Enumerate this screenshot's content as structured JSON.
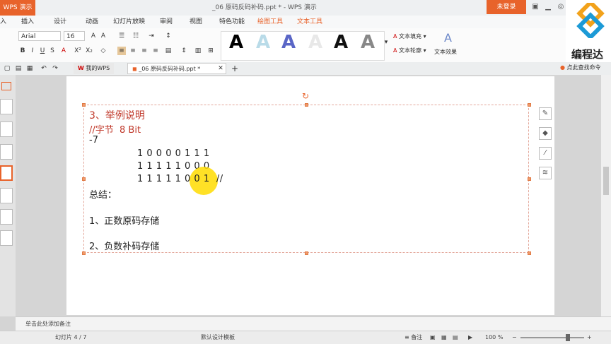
{
  "titlebar": {
    "app_label": "WPS 演示",
    "doc_title": "_06 原码反码补码.ppt * - WPS 演示",
    "login_label": "未登录",
    "controls": [
      "restore-icon",
      "minimize-icon",
      "maximize-icon",
      "close-icon"
    ]
  },
  "menu": {
    "items": [
      "入",
      "插入",
      "设计",
      "动画",
      "幻灯片放映",
      "审阅",
      "视图",
      "特色功能",
      "绘图工具",
      "文本工具"
    ],
    "active": "文本工具"
  },
  "toolbar": {
    "font_name": "Arial",
    "font_size": "16",
    "text_fill_label": "文本填充",
    "text_outline_label": "文本轮廓",
    "text_effect_label": "文本效果"
  },
  "logo": {
    "text": "编程达"
  },
  "tabs": {
    "home_tab": "我的WPS",
    "doc_tab": "_06 原码反码补码.ppt *",
    "search_label": "点此查找命令"
  },
  "slide": {
    "line1": "3、举例说明",
    "line2": "//字节  8 Bit",
    "line3": "-7",
    "line4": "1 0 0 0 0 1 1 1",
    "line5": "1 1 1 1 1 0 0 0",
    "line6": "1 1 1 1 1 0 0 1  //",
    "line7": "总结：",
    "line8": "1、正数原码存储",
    "line9": "2、负数补码存储"
  },
  "notes": {
    "placeholder": "单击此处添加备注"
  },
  "status": {
    "slide_count": "幻灯片 4 / 7",
    "template": "默认设计模板",
    "notes_label": "备注",
    "zoom": "100 %"
  },
  "colors": {
    "accent": "#e8632b",
    "heading": "#c0392b"
  }
}
